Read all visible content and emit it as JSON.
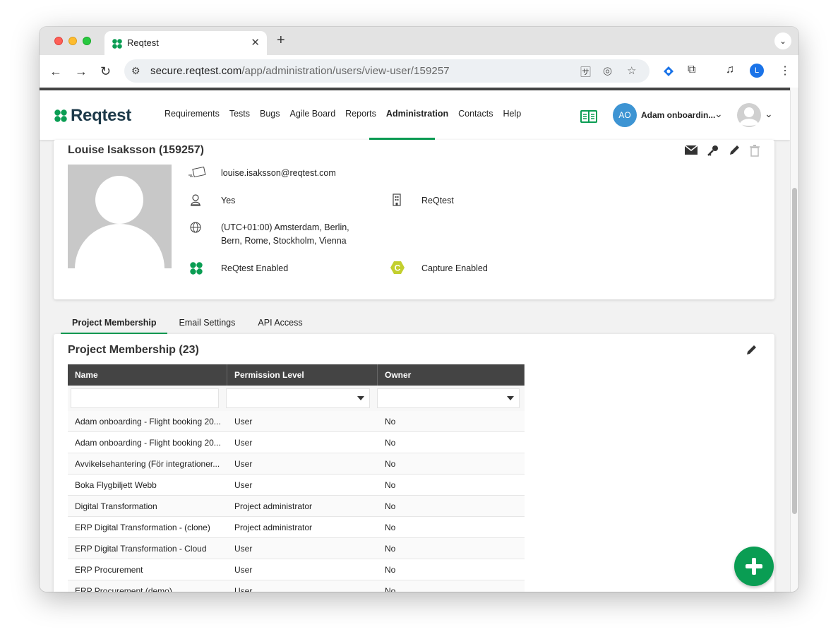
{
  "browser": {
    "tab_title": "Reqtest",
    "tab_close": "✕",
    "new_tab": "+",
    "url_host": "secure.reqtest.com",
    "url_path": "/app/administration/users/view-user/159257",
    "profile_initial": "L"
  },
  "app": {
    "logo_text": "Reqtest",
    "menu": [
      "Requirements",
      "Tests",
      "Bugs",
      "Agile Board",
      "Reports",
      "Administration",
      "Contacts",
      "Help"
    ],
    "active_menu": "Administration",
    "account_initials": "AO",
    "account_name": "Adam onboardin..."
  },
  "profile": {
    "title": "Louise Isaksson (159257)",
    "email": "louise.isaksson@reqtest.com",
    "admin": "Yes",
    "company": "ReQtest",
    "timezone_line1": "(UTC+01:00) Amsterdam, Berlin,",
    "timezone_line2": "Bern, Rome, Stockholm, Vienna",
    "reqtest_status": "ReQtest Enabled",
    "capture_status": "Capture Enabled",
    "capture_icon_letter": "C"
  },
  "tabs": [
    "Project Membership",
    "Email Settings",
    "API Access"
  ],
  "membership": {
    "title": "Project Membership (23)",
    "columns": [
      "Name",
      "Permission Level",
      "Owner"
    ],
    "rows": [
      [
        "Adam onboarding - Flight booking 20...",
        "User",
        "No"
      ],
      [
        "Adam onboarding - Flight booking 20...",
        "User",
        "No"
      ],
      [
        "Avvikelsehantering (För integrationer...",
        "User",
        "No"
      ],
      [
        "Boka Flygbiljett Webb",
        "User",
        "No"
      ],
      [
        "Digital Transformation",
        "Project administrator",
        "No"
      ],
      [
        "ERP Digital Transformation - (clone)",
        "Project administrator",
        "No"
      ],
      [
        "ERP Digital Transformation - Cloud",
        "User",
        "No"
      ],
      [
        "ERP Procurement",
        "User",
        "No"
      ],
      [
        "ERP Procurement (demo)",
        "User",
        "No"
      ]
    ]
  },
  "colors": {
    "brand_green": "#0a9d53",
    "grid_header": "#444444",
    "account_blue": "#3d94d3",
    "capture_yellow": "#c3cf2e"
  }
}
